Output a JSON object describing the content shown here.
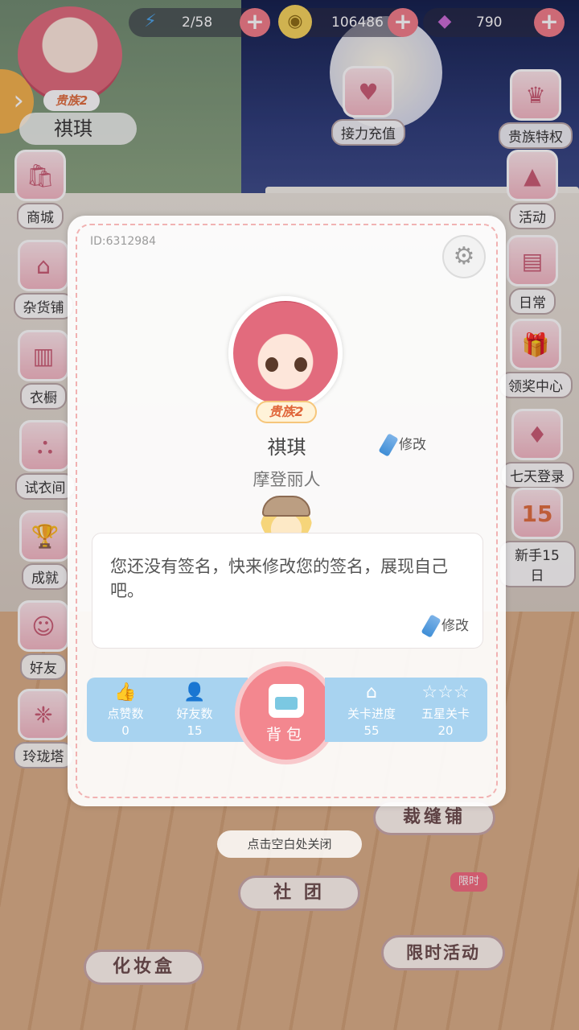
{
  "top_bar": {
    "stamina": "2/58",
    "coins": "106486",
    "gems": "790"
  },
  "player_corner": {
    "vip": "贵族2",
    "name": "祺琪"
  },
  "left_menu": [
    {
      "label": "商城",
      "icon": "shop-icon"
    },
    {
      "label": "杂货铺",
      "icon": "store-icon"
    },
    {
      "label": "衣橱",
      "icon": "wardrobe-icon"
    },
    {
      "label": "试衣间",
      "icon": "fitting-room-icon"
    },
    {
      "label": "成就",
      "icon": "trophy-icon"
    },
    {
      "label": "好友",
      "icon": "friends-icon"
    },
    {
      "label": "玲珑塔",
      "icon": "tower-icon"
    }
  ],
  "right_menu": [
    {
      "label": "接力充值",
      "icon": "bear-gift-icon"
    },
    {
      "label": "贵族特权",
      "icon": "noble-icon"
    },
    {
      "label": "活动",
      "icon": "party-hat-icon"
    },
    {
      "label": "日常",
      "icon": "book-icon"
    },
    {
      "label": "领奖中心",
      "icon": "gift-box-icon"
    },
    {
      "label": "七天登录",
      "icon": "dress-icon"
    },
    {
      "label": "新手15日",
      "icon": "calendar-icon",
      "day": "15"
    }
  ],
  "bottom_menu": {
    "club": "社 团",
    "makeup": "化妆盒",
    "tailor": "裁缝铺",
    "limited": "限时活动",
    "limited_badge": "限时"
  },
  "profile": {
    "id_text": "ID:6312984",
    "vip": "贵族2",
    "name": "祺琪",
    "edit_label": "修改",
    "title": "摩登丽人",
    "signature": "您还没有签名，快来修改您的签名，展现自己吧。",
    "signature_edit": "修改",
    "stats": {
      "likes_label": "点赞数",
      "likes": "0",
      "friends_label": "好友数",
      "friends": "15",
      "progress_label": "关卡进度",
      "progress": "55",
      "stars_label": "五星关卡",
      "stars": "20"
    },
    "bag_label": "背包"
  },
  "close_hint": "点击空白处关闭",
  "colors": {
    "accent_pink": "#f3878f",
    "stat_blue": "#a8d3f0",
    "vip_orange": "#e0663a"
  }
}
